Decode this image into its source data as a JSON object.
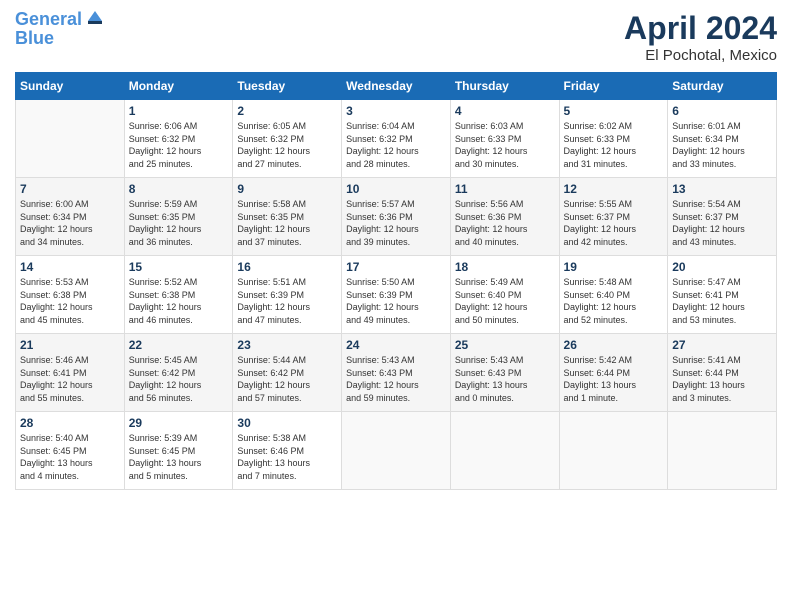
{
  "header": {
    "logo_line1": "General",
    "logo_line2": "Blue",
    "month_title": "April 2024",
    "location": "El Pochotal, Mexico"
  },
  "days_of_week": [
    "Sunday",
    "Monday",
    "Tuesday",
    "Wednesday",
    "Thursday",
    "Friday",
    "Saturday"
  ],
  "weeks": [
    [
      {
        "num": "",
        "info": ""
      },
      {
        "num": "1",
        "info": "Sunrise: 6:06 AM\nSunset: 6:32 PM\nDaylight: 12 hours\nand 25 minutes."
      },
      {
        "num": "2",
        "info": "Sunrise: 6:05 AM\nSunset: 6:32 PM\nDaylight: 12 hours\nand 27 minutes."
      },
      {
        "num": "3",
        "info": "Sunrise: 6:04 AM\nSunset: 6:32 PM\nDaylight: 12 hours\nand 28 minutes."
      },
      {
        "num": "4",
        "info": "Sunrise: 6:03 AM\nSunset: 6:33 PM\nDaylight: 12 hours\nand 30 minutes."
      },
      {
        "num": "5",
        "info": "Sunrise: 6:02 AM\nSunset: 6:33 PM\nDaylight: 12 hours\nand 31 minutes."
      },
      {
        "num": "6",
        "info": "Sunrise: 6:01 AM\nSunset: 6:34 PM\nDaylight: 12 hours\nand 33 minutes."
      }
    ],
    [
      {
        "num": "7",
        "info": "Sunrise: 6:00 AM\nSunset: 6:34 PM\nDaylight: 12 hours\nand 34 minutes."
      },
      {
        "num": "8",
        "info": "Sunrise: 5:59 AM\nSunset: 6:35 PM\nDaylight: 12 hours\nand 36 minutes."
      },
      {
        "num": "9",
        "info": "Sunrise: 5:58 AM\nSunset: 6:35 PM\nDaylight: 12 hours\nand 37 minutes."
      },
      {
        "num": "10",
        "info": "Sunrise: 5:57 AM\nSunset: 6:36 PM\nDaylight: 12 hours\nand 39 minutes."
      },
      {
        "num": "11",
        "info": "Sunrise: 5:56 AM\nSunset: 6:36 PM\nDaylight: 12 hours\nand 40 minutes."
      },
      {
        "num": "12",
        "info": "Sunrise: 5:55 AM\nSunset: 6:37 PM\nDaylight: 12 hours\nand 42 minutes."
      },
      {
        "num": "13",
        "info": "Sunrise: 5:54 AM\nSunset: 6:37 PM\nDaylight: 12 hours\nand 43 minutes."
      }
    ],
    [
      {
        "num": "14",
        "info": "Sunrise: 5:53 AM\nSunset: 6:38 PM\nDaylight: 12 hours\nand 45 minutes."
      },
      {
        "num": "15",
        "info": "Sunrise: 5:52 AM\nSunset: 6:38 PM\nDaylight: 12 hours\nand 46 minutes."
      },
      {
        "num": "16",
        "info": "Sunrise: 5:51 AM\nSunset: 6:39 PM\nDaylight: 12 hours\nand 47 minutes."
      },
      {
        "num": "17",
        "info": "Sunrise: 5:50 AM\nSunset: 6:39 PM\nDaylight: 12 hours\nand 49 minutes."
      },
      {
        "num": "18",
        "info": "Sunrise: 5:49 AM\nSunset: 6:40 PM\nDaylight: 12 hours\nand 50 minutes."
      },
      {
        "num": "19",
        "info": "Sunrise: 5:48 AM\nSunset: 6:40 PM\nDaylight: 12 hours\nand 52 minutes."
      },
      {
        "num": "20",
        "info": "Sunrise: 5:47 AM\nSunset: 6:41 PM\nDaylight: 12 hours\nand 53 minutes."
      }
    ],
    [
      {
        "num": "21",
        "info": "Sunrise: 5:46 AM\nSunset: 6:41 PM\nDaylight: 12 hours\nand 55 minutes."
      },
      {
        "num": "22",
        "info": "Sunrise: 5:45 AM\nSunset: 6:42 PM\nDaylight: 12 hours\nand 56 minutes."
      },
      {
        "num": "23",
        "info": "Sunrise: 5:44 AM\nSunset: 6:42 PM\nDaylight: 12 hours\nand 57 minutes."
      },
      {
        "num": "24",
        "info": "Sunrise: 5:43 AM\nSunset: 6:43 PM\nDaylight: 12 hours\nand 59 minutes."
      },
      {
        "num": "25",
        "info": "Sunrise: 5:43 AM\nSunset: 6:43 PM\nDaylight: 13 hours\nand 0 minutes."
      },
      {
        "num": "26",
        "info": "Sunrise: 5:42 AM\nSunset: 6:44 PM\nDaylight: 13 hours\nand 1 minute."
      },
      {
        "num": "27",
        "info": "Sunrise: 5:41 AM\nSunset: 6:44 PM\nDaylight: 13 hours\nand 3 minutes."
      }
    ],
    [
      {
        "num": "28",
        "info": "Sunrise: 5:40 AM\nSunset: 6:45 PM\nDaylight: 13 hours\nand 4 minutes."
      },
      {
        "num": "29",
        "info": "Sunrise: 5:39 AM\nSunset: 6:45 PM\nDaylight: 13 hours\nand 5 minutes."
      },
      {
        "num": "30",
        "info": "Sunrise: 5:38 AM\nSunset: 6:46 PM\nDaylight: 13 hours\nand 7 minutes."
      },
      {
        "num": "",
        "info": ""
      },
      {
        "num": "",
        "info": ""
      },
      {
        "num": "",
        "info": ""
      },
      {
        "num": "",
        "info": ""
      }
    ]
  ]
}
